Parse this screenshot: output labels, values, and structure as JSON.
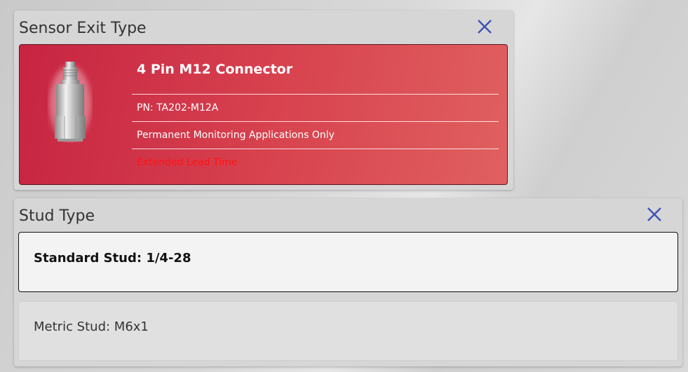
{
  "sensor_panel": {
    "title": "Sensor Exit Type",
    "close_icon": "close-icon",
    "selected_option": {
      "title": "4 Pin M12 Connector",
      "pn": "PN: TA202-M12A",
      "note": "Permanent Monitoring Applications Only",
      "warning": "Extended Lead Time",
      "image_icon": "sensor-product-image"
    }
  },
  "stud_panel": {
    "title": "Stud Type",
    "close_icon": "close-icon",
    "options": [
      {
        "label": "Standard Stud: 1/4-28",
        "selected": true
      },
      {
        "label": "Metric Stud: M6x1",
        "selected": false
      }
    ]
  },
  "colors": {
    "accent_blue": "#3f51b5",
    "card_red_start": "#c72442",
    "card_red_end": "#e06060",
    "warning_red": "#ff1414"
  }
}
